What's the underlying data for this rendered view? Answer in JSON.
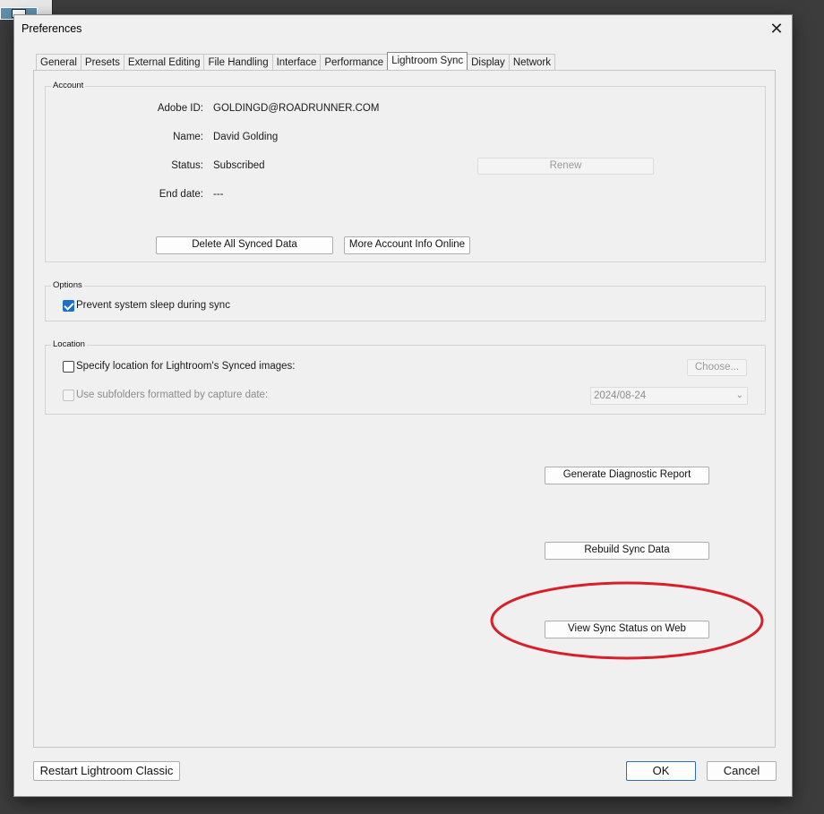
{
  "dialog": {
    "title": "Preferences",
    "close_icon": "close-icon"
  },
  "tabs": [
    {
      "label": "General"
    },
    {
      "label": "Presets"
    },
    {
      "label": "External Editing"
    },
    {
      "label": "File Handling"
    },
    {
      "label": "Interface"
    },
    {
      "label": "Performance"
    },
    {
      "label": "Lightroom Sync",
      "active": true
    },
    {
      "label": "Display"
    },
    {
      "label": "Network"
    }
  ],
  "account": {
    "group_label": "Account",
    "adobe_id_label": "Adobe ID:",
    "adobe_id_value": "GOLDINGD@ROADRUNNER.COM",
    "name_label": "Name:",
    "name_value": "David Golding",
    "status_label": "Status:",
    "status_value": "Subscribed",
    "end_date_label": "End date:",
    "end_date_value": "---",
    "renew_label": "Renew",
    "delete_synced_label": "Delete All Synced Data",
    "more_info_label": "More Account Info Online"
  },
  "options": {
    "group_label": "Options",
    "prevent_sleep_label": "Prevent system sleep during sync",
    "prevent_sleep_checked": true
  },
  "location": {
    "group_label": "Location",
    "specify_location_label": "Specify location for Lightroom's Synced images:",
    "specify_location_checked": false,
    "choose_label": "Choose...",
    "subfolders_label": "Use subfolders formatted by capture date:",
    "subfolders_checked": false,
    "date_format_value": "2024/08-24"
  },
  "actions": {
    "diagnostic_label": "Generate Diagnostic Report",
    "rebuild_label": "Rebuild Sync Data",
    "view_status_label": "View Sync Status on Web"
  },
  "footer": {
    "restart_label": "Restart Lightroom Classic",
    "ok_label": "OK",
    "cancel_label": "Cancel"
  },
  "annotation": {
    "highlight_color": "#d9202a"
  }
}
